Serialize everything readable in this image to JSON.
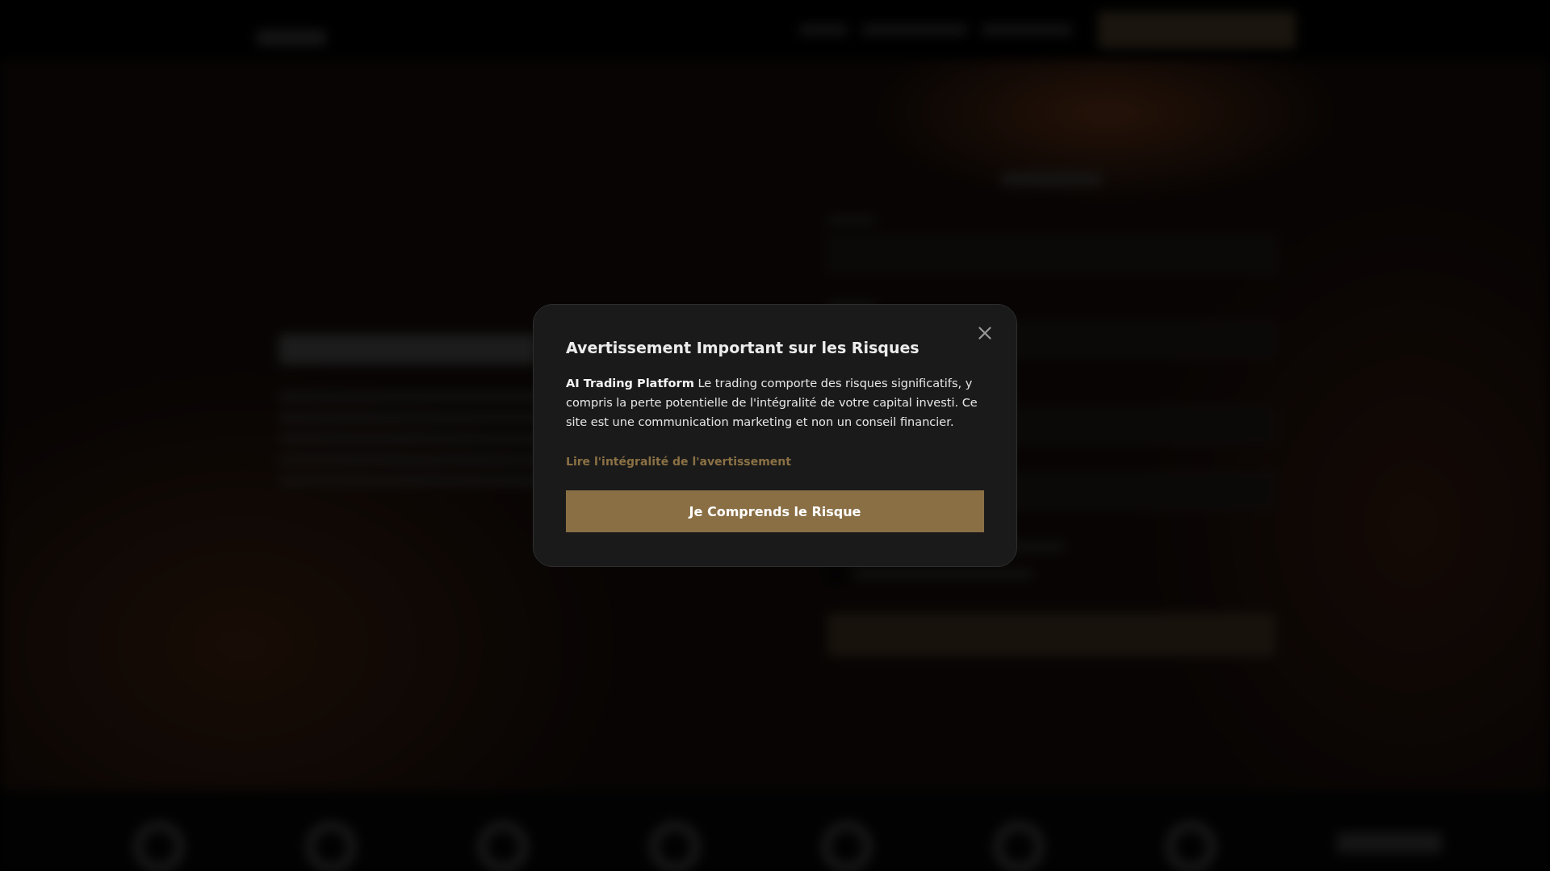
{
  "modal": {
    "title": "Avertissement Important sur les Risques",
    "body": "**AI Trading Platform** Le trading comporte des risques significatifs, y compris la perte potentielle de l'intégralité de votre capital investi. Ce site est une communication marketing et non un conseil financier.",
    "link": "Lire l'intégralité de l'avertissement",
    "button": "Je Comprends le Risque"
  }
}
